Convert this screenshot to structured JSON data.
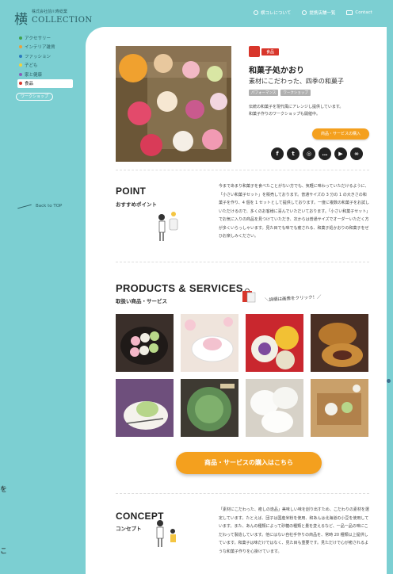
{
  "logo": {
    "kanji": "横",
    "sub": "株式会社前川寿総業",
    "word": "COLLECTION"
  },
  "sidebar": {
    "items": [
      {
        "label": "アクセサリー",
        "color": "#3fa34d"
      },
      {
        "label": "インテリア雑貨",
        "color": "#e9a03b"
      },
      {
        "label": "ファッション",
        "color": "#2b7bbf"
      },
      {
        "label": "子ども",
        "color": "#f0d23c"
      },
      {
        "label": "家と健康",
        "color": "#8a5cb8"
      },
      {
        "label": "食品",
        "color": "#d8362b"
      }
    ],
    "workshop": "ワークショップ",
    "back_to_top": "Back to TOP"
  },
  "topbar": {
    "about": "横コレについて",
    "shops": "提携店舗一覧",
    "contact": "Contact"
  },
  "hero": {
    "category": "食品",
    "name": "和菓子処かおり",
    "catch": "素材にこだわった、四季の和菓子",
    "tags": [
      "パフォーマンス",
      "ワークショップ"
    ],
    "desc_line1": "伝統の和菓子を現代風にアレンジし提供しています。",
    "desc_line2": "和菓子作りのワークショップも開催中。",
    "buy_button_small": "商品・サービスの購入"
  },
  "socials": [
    "f",
    "t",
    "◎",
    "…",
    "▶",
    "∞"
  ],
  "point": {
    "title": "POINT",
    "subtitle": "おすすめポイント",
    "text": "今まであまり和菓子を食べたことがない方でも、気軽に味わっていただけるように、「小さい和菓子セット」を販売しております。普通サイズの 3 分の 1 の大きさの和菓子を作り、4 個を 1 セットとして提供しております。一度に複数の和菓子をお試しいただけるので、多くのお客様に喜んでいただいております。「小さい和菓子セット」でお気に入りの商品を見つけていただき、次からは普通サイズでオーダーいただく方が多くいらっしゃいます。見た目でも味でも癒される、和菓子処かおりの和菓子をぜひお楽しみください。"
  },
  "products": {
    "title": "PRODUCTS & SERVICES",
    "subtitle": "取扱い商品・サービス",
    "hint": "＼詳細は画像をクリック！／",
    "buy_button": "商品・サービスの購入はこちら"
  },
  "concept": {
    "title": "CONCEPT",
    "subtitle": "コンセプト",
    "text": "「素材にこだわった、癒しの逸品」美味しい味を創り出すため、こだわりの素材を選定しています。たとえば、団子は国産米粉を使用、和あんは北海道の小豆を使用しています。また、あんの種類によって砂糖の種類と量を変えるなど、一品一品の味にこだわって製造しています。他にはない自社手作りの商品を、常時 20 種類以上提供しています。和菓子は味だけではなく、見た目も重要です。見ただけで心が癒されるような和菓子作りを心掛けています。"
  },
  "edge_glyphs": [
    "を",
    "こ"
  ]
}
